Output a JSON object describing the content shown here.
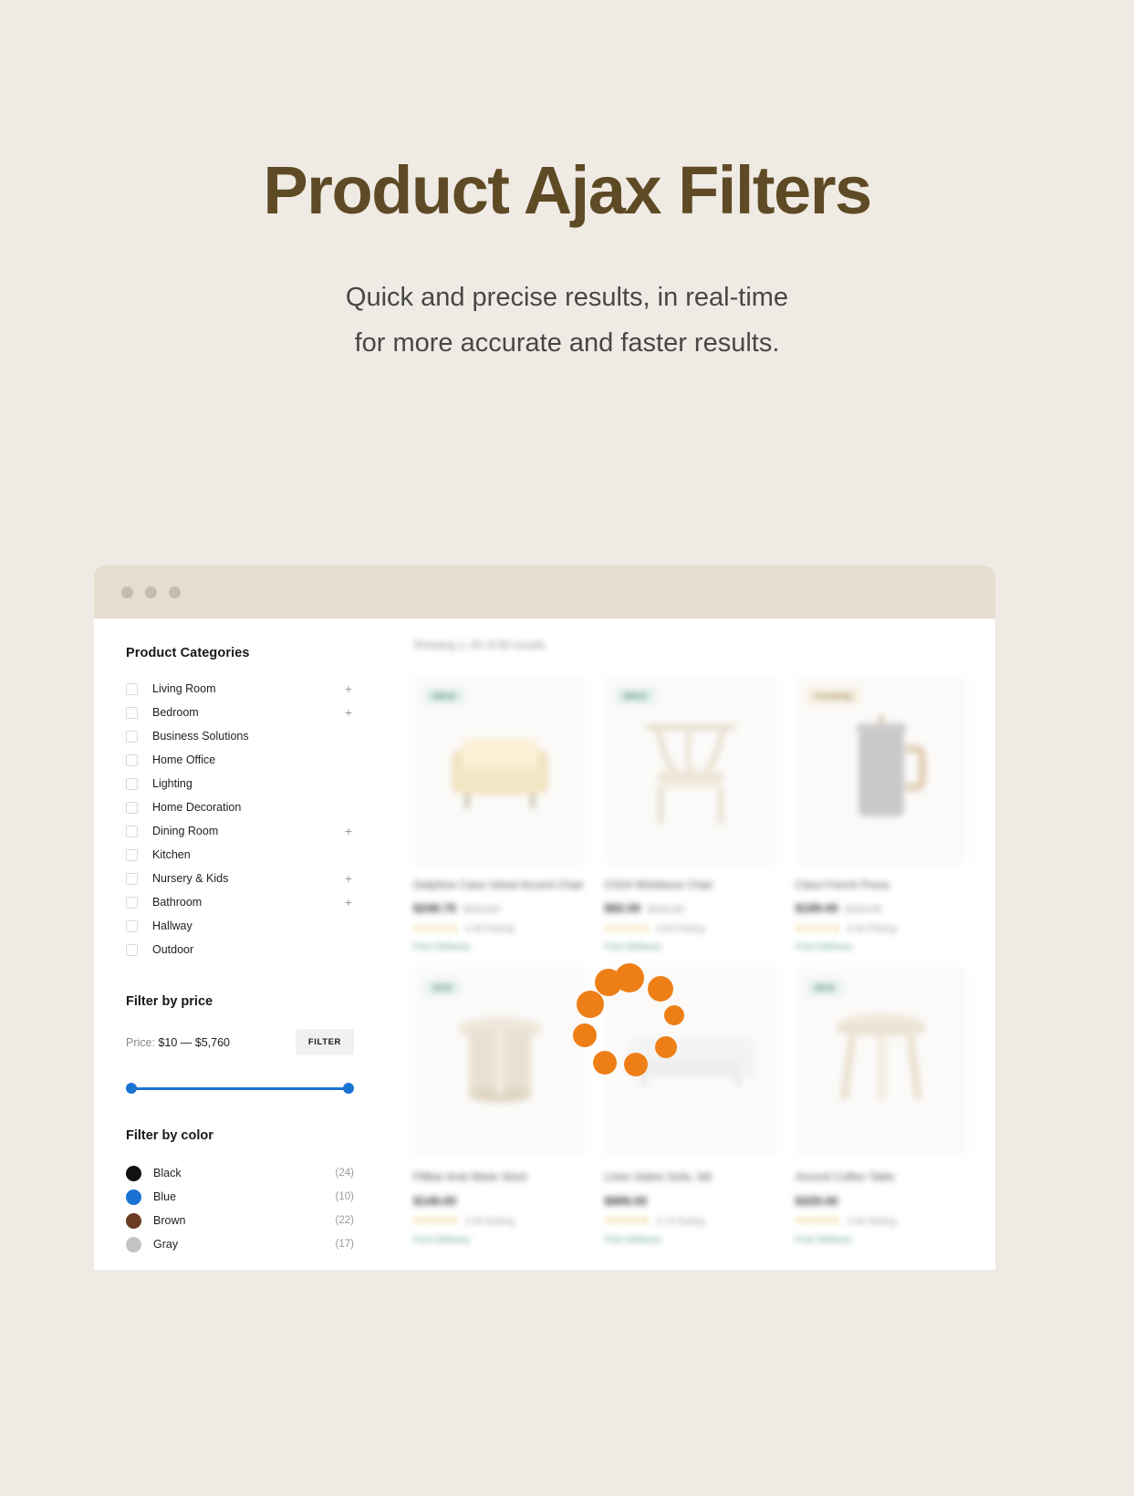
{
  "hero": {
    "title": "Product Ajax Filters",
    "subtitle_line1": "Quick and precise results, in real-time",
    "subtitle_line2": "for more accurate and faster results."
  },
  "browser": {
    "dots": [
      "dot-red",
      "dot-yellow",
      "dot-green"
    ]
  },
  "sidebar": {
    "categories_title": "Product Categories",
    "categories": [
      {
        "label": "Living Room",
        "expandable": "+"
      },
      {
        "label": "Bedroom",
        "expandable": "+"
      },
      {
        "label": "Business Solutions",
        "expandable": ""
      },
      {
        "label": "Home Office",
        "expandable": ""
      },
      {
        "label": "Lighting",
        "expandable": ""
      },
      {
        "label": "Home Decoration",
        "expandable": ""
      },
      {
        "label": "Dining Room",
        "expandable": "+"
      },
      {
        "label": "Kitchen",
        "expandable": ""
      },
      {
        "label": "Nursery & Kids",
        "expandable": "+"
      },
      {
        "label": "Bathroom",
        "expandable": "+"
      },
      {
        "label": "Hallway",
        "expandable": ""
      },
      {
        "label": "Outdoor",
        "expandable": ""
      }
    ],
    "price": {
      "title": "Filter by price",
      "prefix": "Price:",
      "range": "$10 — $5,760",
      "min": "$10",
      "max": "$5,760",
      "filter_button": "FILTER",
      "slider_color": "#1A73D2"
    },
    "color": {
      "title": "Filter by color",
      "items": [
        {
          "name": "Black",
          "count": "(24)",
          "hex": "#111111"
        },
        {
          "name": "Blue",
          "count": "(10)",
          "hex": "#1A73D2"
        },
        {
          "name": "Brown",
          "count": "(22)",
          "hex": "#6B3A22"
        },
        {
          "name": "Gray",
          "count": "(17)",
          "hex": "#C4C4C4"
        }
      ]
    }
  },
  "main": {
    "results_text": "Showing 1–20 of 60 results",
    "loading": true,
    "spinner_color": "#EE7F17",
    "products": [
      {
        "badge": "SALE",
        "badge_type": "sale",
        "title": "Delphine Cane Velvet Accent Chair",
        "price": "$249.70",
        "old_price": "$310.00",
        "rating": "4.45 Rating",
        "shipping": "Free Delivery"
      },
      {
        "badge": "SALE",
        "badge_type": "sale",
        "title": "CH24 Wishbone Chair",
        "price": "$92.00",
        "old_price": "$120.00",
        "rating": "4.80 Rating",
        "shipping": "Free Delivery"
      },
      {
        "badge": "Trending",
        "badge_type": "trend",
        "title": "Clara French Press",
        "price": "$189.00",
        "old_price": "$220.00",
        "rating": "4.60 Rating",
        "shipping": "Free Delivery"
      },
      {
        "badge": "NEW",
        "badge_type": "dash",
        "title": "Pillbar Arsk Marle Stool",
        "price": "$149.00",
        "old_price": "",
        "rating": "4.30 Rating",
        "shipping": "Free Delivery"
      },
      {
        "badge": "",
        "badge_type": "",
        "title": "Linen Saline Sofa, 3dt",
        "price": "$989.00",
        "old_price": "",
        "rating": "4.70 Rating",
        "shipping": "Free Delivery"
      },
      {
        "badge": "NEW",
        "badge_type": "dash",
        "title": "Around Coffee Table",
        "price": "$329.00",
        "old_price": "",
        "rating": "4.50 Rating",
        "shipping": "Free Delivery"
      }
    ]
  },
  "theme": {
    "page_background": "#EFEBE4",
    "title_color": "#5E4A24",
    "titlebar_color": "#E7DDCF",
    "accent_orange": "#EE7F17"
  }
}
